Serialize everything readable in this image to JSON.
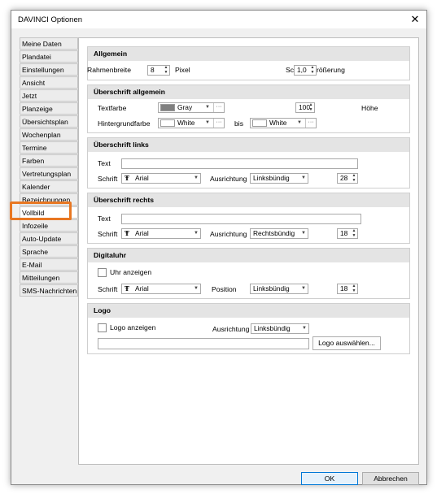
{
  "window": {
    "title": "DAVINCI Optionen",
    "close_glyph": "✕"
  },
  "nav": {
    "items": [
      "Meine Daten",
      "Plandatei",
      "Einstellungen",
      "Ansicht",
      "Jetzt",
      "Planzeige",
      "Übersichtsplan",
      "Wochenplan",
      "Termine",
      "Farben",
      "Vertretungsplan",
      "Kalender",
      "Bezeichnungen",
      "Vollbild",
      "Infozeile",
      "Auto-Update",
      "Sprache",
      "E-Mail",
      "Mitteilungen",
      "SMS-Nachrichten"
    ],
    "selected": "Vollbild"
  },
  "allgemein": {
    "header": "Allgemein",
    "rahmenbreite_label": "Rahmenbreite",
    "rahmenbreite_value": "8",
    "pixel_label": "Pixel",
    "sch_label": "Sc",
    "zoom_value": "1,0",
    "vergr_label": "rößerung"
  },
  "ueberschrift_allgemein": {
    "header": "Überschrift allgemein",
    "textfarbe_label": "Textfarbe",
    "textfarbe_value": "Gray",
    "textfarbe_color": "#7f7f7f",
    "hoehe_value": "100",
    "hoehe_label": "Höhe",
    "hintergrund_label": "Hintergrundfarbe",
    "hintergrund_value": "White",
    "bis_label": "bis",
    "bis_value": "White",
    "white_color": "#ffffff",
    "dots": "···"
  },
  "ueberschrift_links": {
    "header": "Überschrift links",
    "text_label": "Text",
    "text_value": "",
    "schrift_label": "Schrift",
    "schrift_value": "Arial",
    "ausrichtung_label": "Ausrichtung",
    "ausrichtung_value": "Linksbündig",
    "size_value": "28"
  },
  "ueberschrift_rechts": {
    "header": "Überschrift rechts",
    "text_label": "Text",
    "text_value": "",
    "schrift_label": "Schrift",
    "schrift_value": "Arial",
    "ausrichtung_label": "Ausrichtung",
    "ausrichtung_value": "Rechtsbündig",
    "size_value": "18"
  },
  "digitaluhr": {
    "header": "Digitaluhr",
    "uhr_label": "Uhr anzeigen",
    "schrift_label": "Schrift",
    "schrift_value": "Arial",
    "position_label": "Position",
    "position_value": "Linksbündig",
    "size_value": "18"
  },
  "logo": {
    "header": "Logo",
    "logo_label": "Logo anzeigen",
    "ausrichtung_label": "Ausrichtung",
    "ausrichtung_value": "Linksbündig",
    "path_value": "",
    "select_button": "Logo auswählen..."
  },
  "footer": {
    "ok": "OK",
    "cancel": "Abbrechen"
  },
  "colors": {
    "highlight": "#e87722",
    "accent": "#0078d7"
  },
  "icons": {
    "font_icon": "Ŧ",
    "dropdown": "▼",
    "spin_up": "▲",
    "spin_down": "▼"
  }
}
